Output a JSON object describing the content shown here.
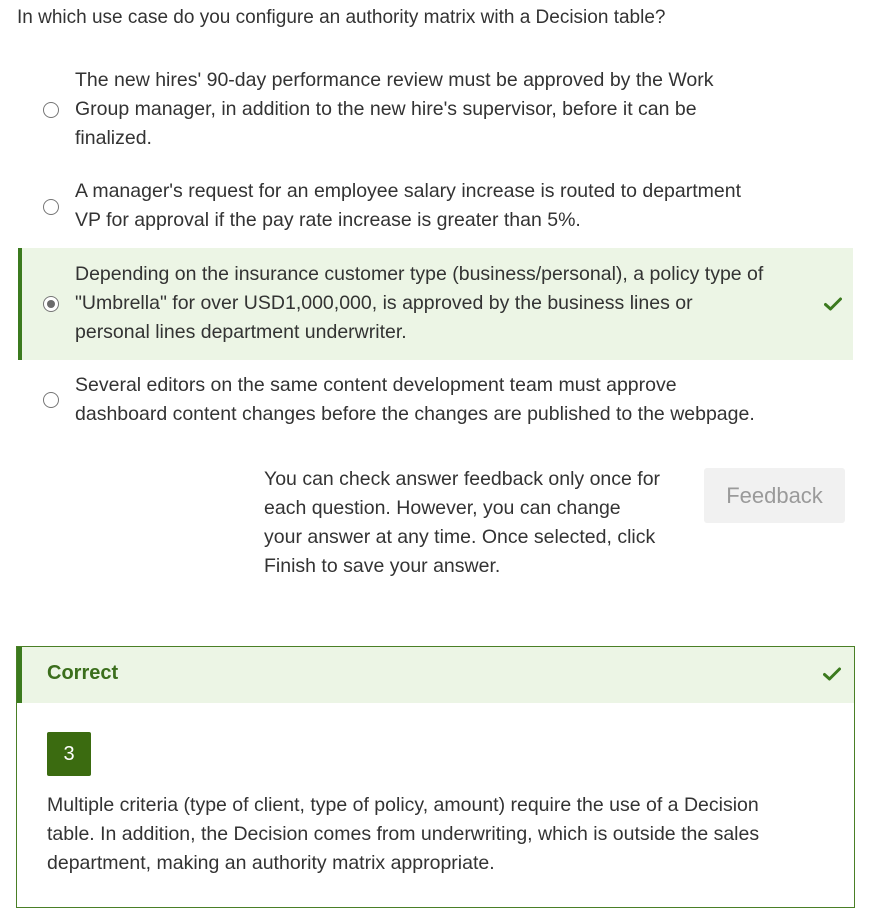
{
  "question": "In which use case do you configure an authority matrix with a Decision table?",
  "options": [
    {
      "lines": [
        "The new hires' 90-day performance review must be approved by the Work",
        "Group manager, in addition to the new hire's supervisor, before it can be",
        "finalized."
      ],
      "selected": false
    },
    {
      "lines": [
        "A manager's request for an employee salary increase is routed to department",
        "VP for approval if the pay rate increase is greater than 5%."
      ],
      "selected": false
    },
    {
      "lines": [
        "Depending on the insurance customer type (business/personal), a policy type of",
        "\"Umbrella\" for over USD1,000,000, is approved by the business lines or",
        "personal lines department underwriter."
      ],
      "selected": true,
      "correct": true
    },
    {
      "lines": [
        "Several editors on the same content development team must approve",
        "dashboard content changes before the changes are published to the webpage."
      ],
      "selected": false
    }
  ],
  "note": {
    "lines": [
      "You can check answer feedback only once for",
      "each question. However, you can change",
      "your answer at any time. Once selected, click",
      "Finish to save your answer."
    ]
  },
  "feedback_button": "Feedback",
  "result": {
    "title": "Correct",
    "answer_number": "3",
    "explanation_lines": [
      "Multiple criteria (type of client, type of policy, amount) require the use of a Decision",
      "table. In addition, the Decision comes from underwriting, which is outside the sales",
      "department, making an authority matrix appropriate."
    ]
  },
  "colors": {
    "accent_green": "#3b7a1e",
    "selected_bg": "#ecf5e5",
    "badge_green": "#3b6b10"
  },
  "icons": {
    "check": "check-icon",
    "radio": "radio-button"
  }
}
